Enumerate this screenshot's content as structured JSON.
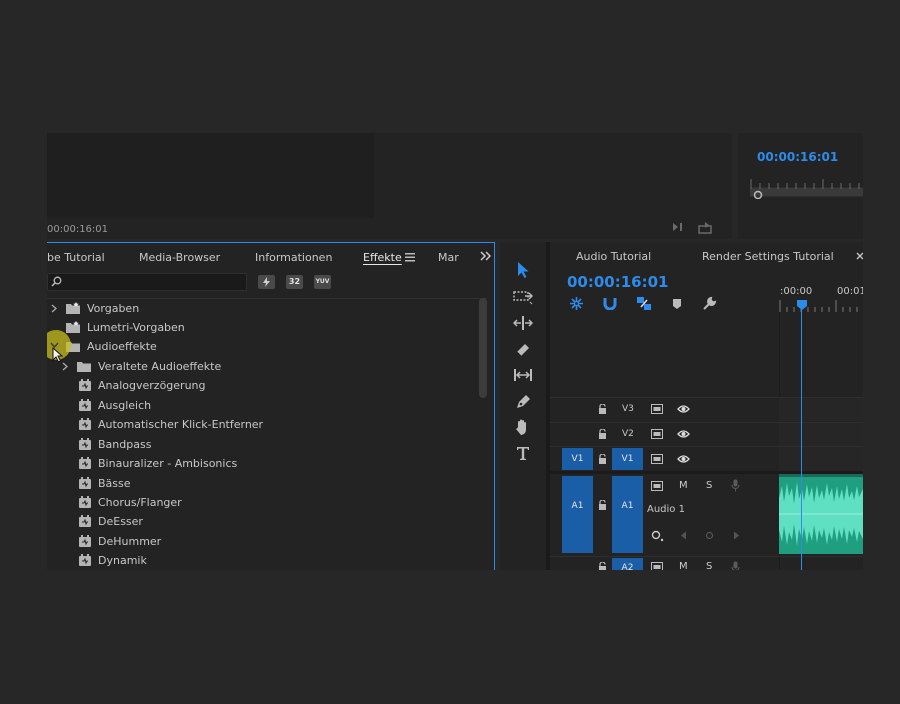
{
  "app": {
    "accent": "#2d8ceb",
    "selected_track": "#1b5ea8",
    "waveform": "#2fc6a0"
  },
  "source_monitor": {
    "timecode": "00:00:16:01"
  },
  "program_monitor": {
    "timecode": "00:00:16:01"
  },
  "effects_panel": {
    "tabs": [
      {
        "label": "be Tutorial"
      },
      {
        "label": "Media-Browser"
      },
      {
        "label": "Informationen"
      },
      {
        "label": "Effekte"
      },
      {
        "label": "Mar"
      }
    ],
    "search": {
      "value": "",
      "placeholder": ""
    },
    "filter_buttons": [
      "32",
      "YUV"
    ],
    "tree": [
      {
        "label": "Vorgaben",
        "kind": "folder",
        "level": 0
      },
      {
        "label": "Lumetri-Vorgaben",
        "kind": "folder",
        "level": 0
      },
      {
        "label": "Audioeffekte",
        "kind": "folder",
        "level": 0,
        "expanded": true
      },
      {
        "label": "Veraltete Audioeffekte",
        "kind": "folder",
        "level": 1
      },
      {
        "label": "Analogverzögerung",
        "kind": "effect",
        "level": 1
      },
      {
        "label": "Ausgleich",
        "kind": "effect",
        "level": 1
      },
      {
        "label": "Automatischer Klick-Entferner",
        "kind": "effect",
        "level": 1
      },
      {
        "label": "Bandpass",
        "kind": "effect",
        "level": 1
      },
      {
        "label": "Binauralizer - Ambisonics",
        "kind": "effect",
        "level": 1
      },
      {
        "label": "Bässe",
        "kind": "effect",
        "level": 1
      },
      {
        "label": "Chorus/Flanger",
        "kind": "effect",
        "level": 1
      },
      {
        "label": "DeEsser",
        "kind": "effect",
        "level": 1
      },
      {
        "label": "DeHummer",
        "kind": "effect",
        "level": 1
      },
      {
        "label": "Dynamik",
        "kind": "effect",
        "level": 1
      }
    ]
  },
  "tools": [
    "selection-tool",
    "track-select-tool",
    "ripple-edit-tool",
    "razor-tool",
    "slip-tool",
    "pen-tool",
    "hand-tool",
    "type-tool"
  ],
  "timeline": {
    "tabs": [
      {
        "label": "Audio Tutorial"
      },
      {
        "label": "Render Settings Tutorial"
      }
    ],
    "timecode": "00:00:16:01",
    "ruler_labels": [
      ":00:00",
      "00:01"
    ],
    "video_tracks": [
      {
        "name": "V3",
        "source": ""
      },
      {
        "name": "V2",
        "source": ""
      },
      {
        "name": "V1",
        "source": "V1"
      }
    ],
    "audio_tracks": [
      {
        "name": "A1",
        "source": "A1",
        "clip_name": "Audio 1",
        "m": "M",
        "s": "S"
      },
      {
        "name": "A2",
        "source": "",
        "m": "M",
        "s": "S"
      }
    ]
  }
}
